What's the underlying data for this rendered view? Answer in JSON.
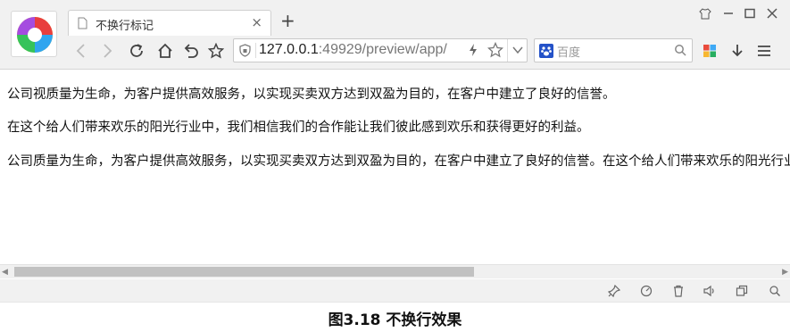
{
  "browser": {
    "tab": {
      "title": "不换行标记",
      "close_glyph": "×"
    },
    "new_tab_glyph": "+",
    "address": {
      "host": "127.0.0.1",
      "rest": ":49929/preview/app/"
    },
    "search": {
      "placeholder": "百度"
    }
  },
  "content": {
    "lines": [
      "公司视质量为生命，为客户提供高效服务，以实现买卖双方达到双盈为目的，在客户中建立了良好的信誉。",
      "在这个给人们带来欢乐的阳光行业中，我们相信我们的合作能让我们彼此感到欢乐和获得更好的利益。",
      "公司质量为生命，为客户提供高效服务，以实现买卖双方达到双盈为目的，在客户中建立了良好的信誉。在这个给人们带来欢乐的阳光行业中，我们相信我们的合作能让我们彼此感到欢乐和获得更好的利益。"
    ]
  },
  "scrollbar": {
    "left_arrow": "◀",
    "right_arrow": "▶",
    "thumb_fraction": 0.58
  },
  "caption": "图3.18  不换行效果",
  "colors": {
    "search_logo": "#2452c8",
    "scroll_thumb": "#c1c1c1"
  }
}
